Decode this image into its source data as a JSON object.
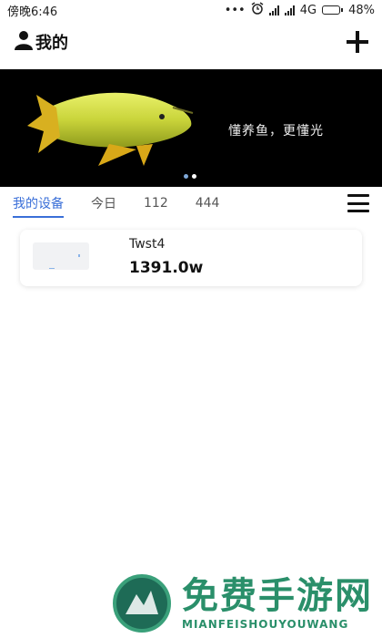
{
  "status_bar": {
    "time": "傍晚6:46",
    "icons": [
      "more-icon",
      "alarm-icon",
      "signal-icon",
      "signal-icon"
    ],
    "network": "4G",
    "battery": "48%",
    "battery_level": 0.48
  },
  "header": {
    "title": "我的",
    "icons": [
      "user-icon",
      "plus-icon"
    ]
  },
  "banner": {
    "text": "懂养鱼，更懂光",
    "image": "arowana-fish",
    "slide_index": 1,
    "slide_count": 2
  },
  "tabs": [
    {
      "label": "我的设备",
      "active": true
    },
    {
      "label": "今日",
      "active": false
    },
    {
      "label": "112",
      "active": false
    },
    {
      "label": "444",
      "active": false
    }
  ],
  "menu_icon": "hamburger-icon",
  "devices": [
    {
      "name": "Twst4",
      "power": "1391.0w"
    }
  ],
  "watermark": {
    "title": "免费手游网",
    "subtitle": "MIANFEISHOUYOUWANG"
  },
  "colors": {
    "accent": "#3a6fd8",
    "banner_bg": "#000000",
    "watermark": "#2a8f6a"
  }
}
